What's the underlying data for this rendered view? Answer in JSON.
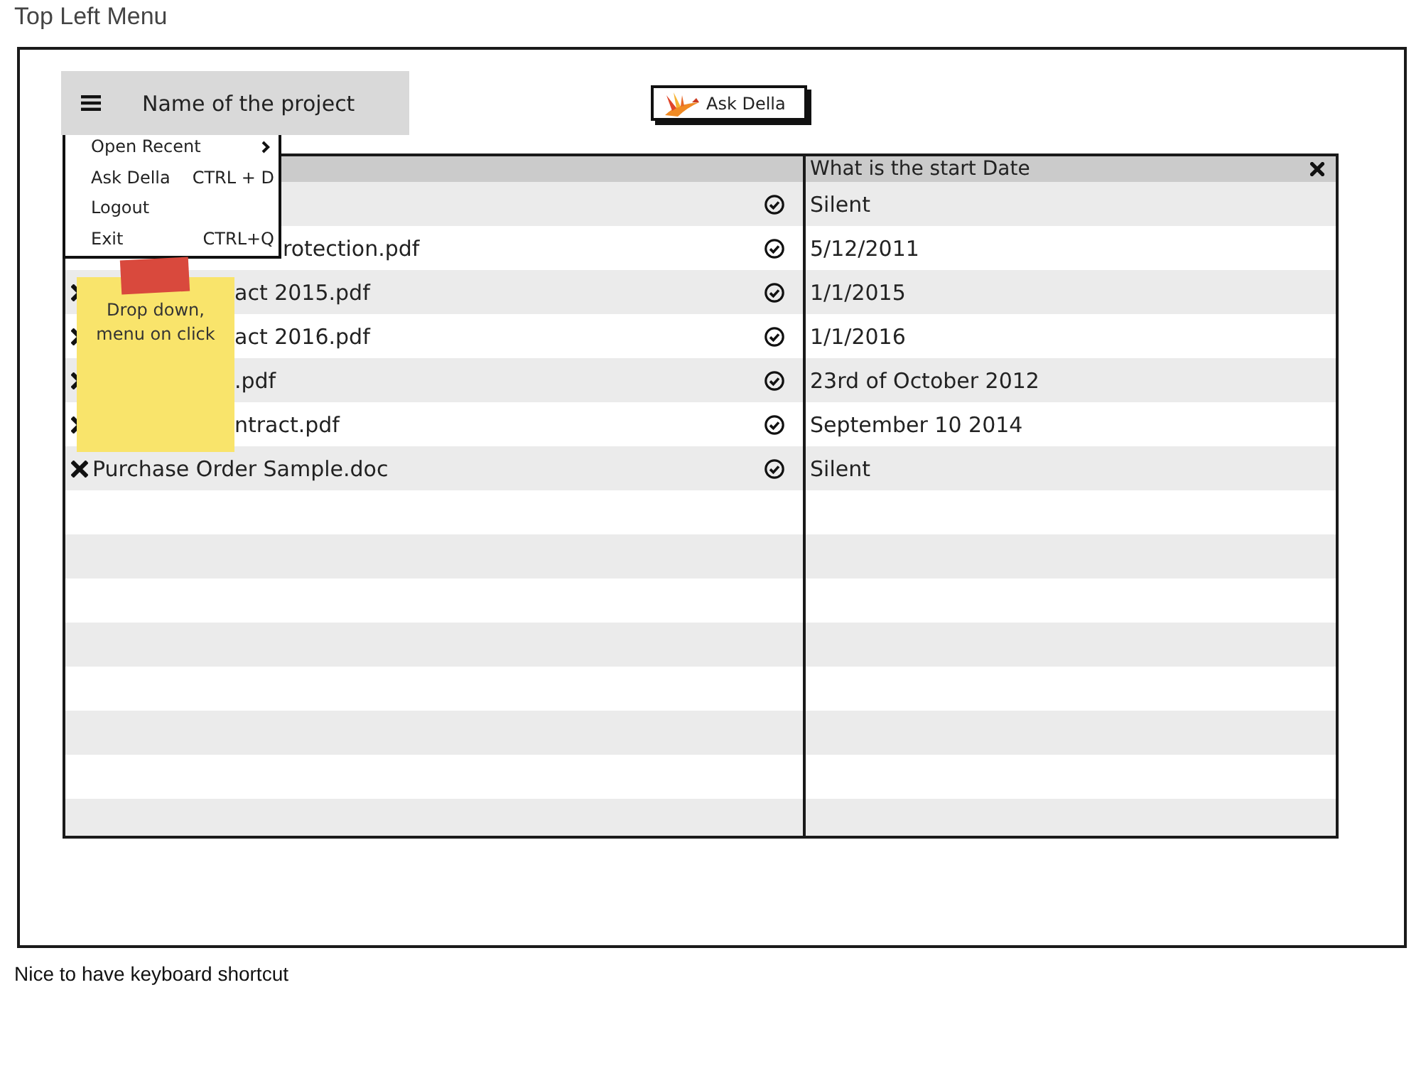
{
  "page": {
    "title": "Top Left Menu",
    "caption": "Nice to have keyboard shortcut"
  },
  "app_bar": {
    "project_name": "Name of the project",
    "ask_button": "Ask Della"
  },
  "menu": {
    "open": true,
    "items": [
      {
        "label": "Open Recent",
        "submenu": true
      },
      {
        "label": "Ask Della",
        "shortcut": "CTRL + D",
        "submenu": false
      },
      {
        "label": "Logout",
        "submenu": false
      },
      {
        "label": "Exit",
        "shortcut": "CTRL+Q",
        "submenu": false
      }
    ]
  },
  "sticky_note": {
    "text": "Drop down, menu on click"
  },
  "table": {
    "date_header": "What is the start Date",
    "rows": [
      {
        "date": "Silent",
        "checked": true
      },
      {
        "name": "rotection.pdf",
        "date": "5/12/2011",
        "checked": true
      },
      {
        "name": "act 2015.pdf",
        "date": "1/1/2015",
        "checked": true
      },
      {
        "name": "act 2016.pdf",
        "date": "1/1/2016",
        "checked": true
      },
      {
        "name": ".pdf",
        "date": "23rd of October 2012",
        "checked": true
      },
      {
        "name": "ntract.pdf",
        "date": "September 10 2014",
        "checked": true
      },
      {
        "name": "Purchase Order Sample.doc",
        "date": "Silent",
        "checked": true
      }
    ]
  }
}
